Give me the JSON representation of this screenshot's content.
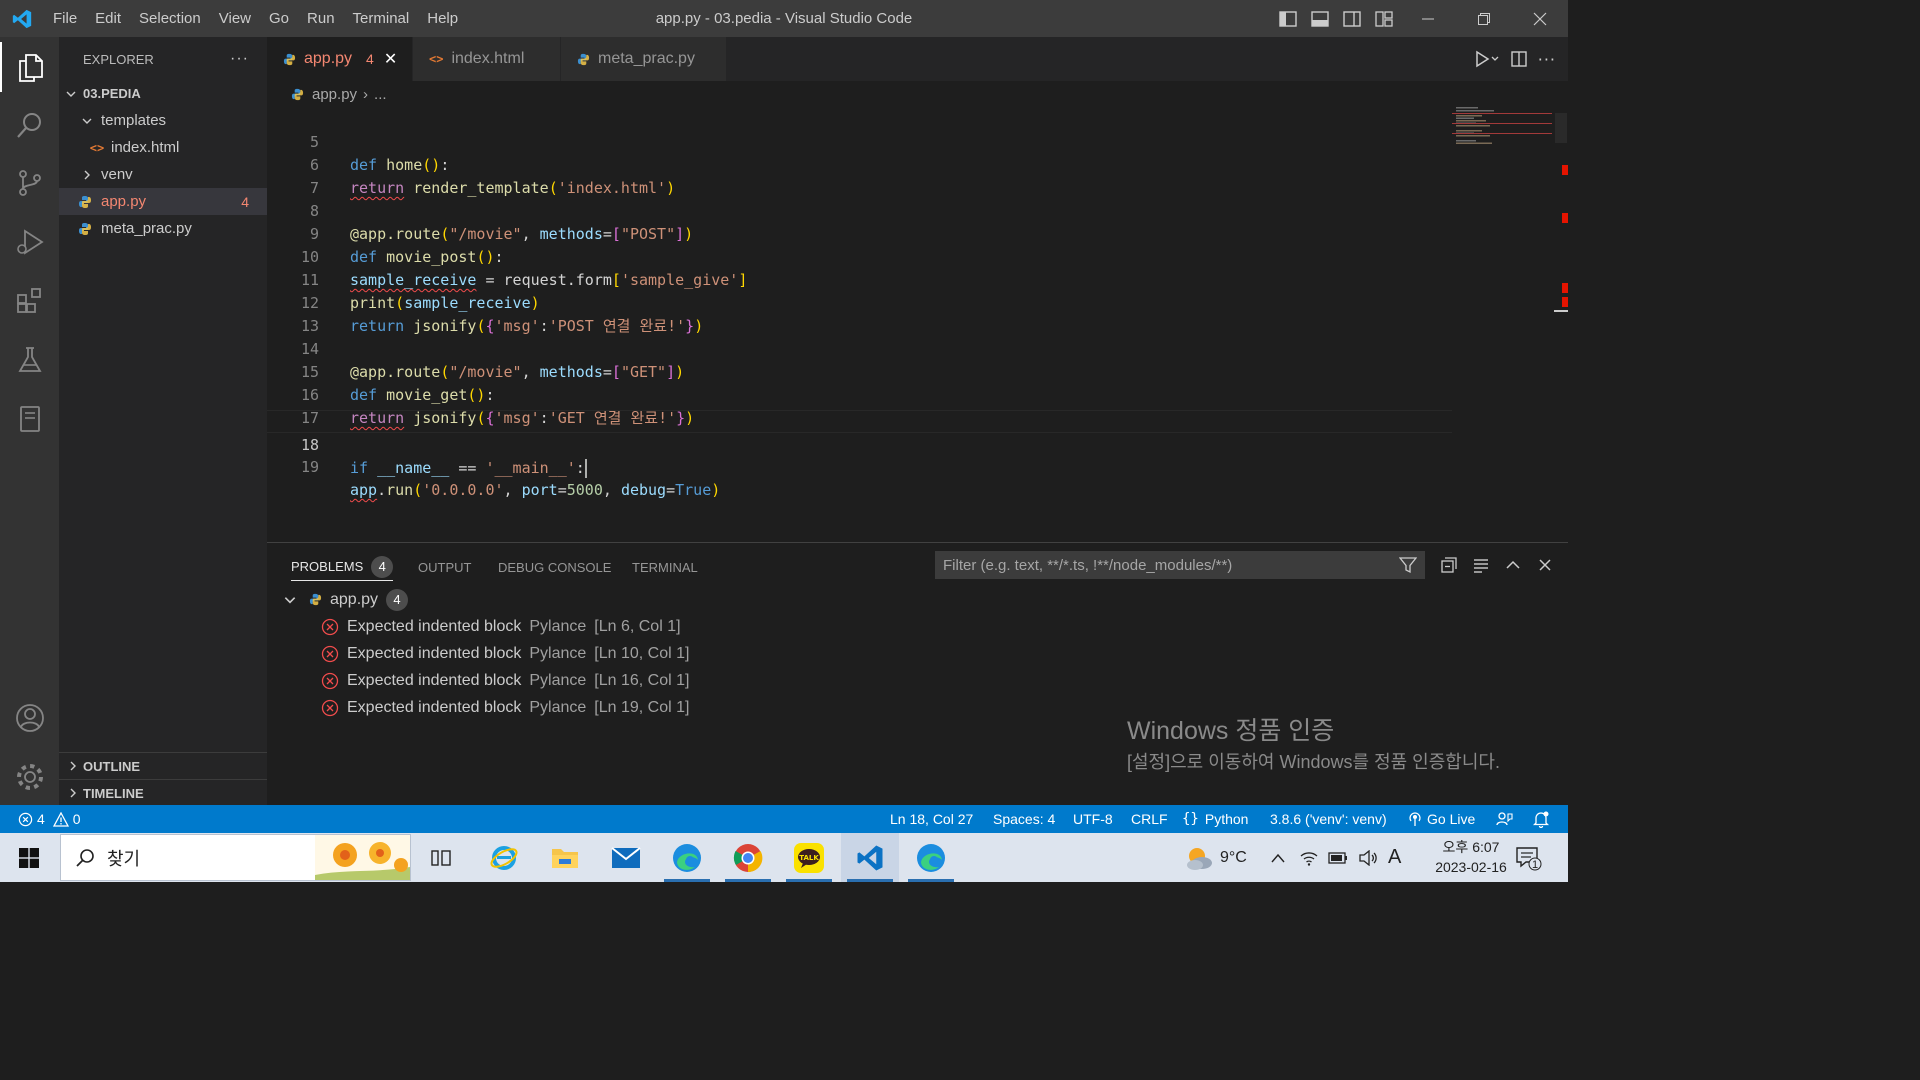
{
  "window": {
    "title": "app.py - 03.pedia - Visual Studio Code",
    "menu": [
      "File",
      "Edit",
      "Selection",
      "View",
      "Go",
      "Run",
      "Terminal",
      "Help"
    ]
  },
  "sidebar": {
    "title": "EXPLORER",
    "more": "···",
    "project": "03.PEDIA",
    "tree": [
      {
        "label": "templates",
        "type": "folder",
        "expanded": true
      },
      {
        "label": "index.html",
        "type": "html"
      },
      {
        "label": "venv",
        "type": "folder",
        "expanded": false
      },
      {
        "label": "app.py",
        "type": "python",
        "badge": "4",
        "selected": true
      },
      {
        "label": "meta_prac.py",
        "type": "python"
      }
    ],
    "outline": "OUTLINE",
    "timeline": "TIMELINE"
  },
  "tabs": [
    {
      "label": "app.py",
      "badge": "4",
      "active": true,
      "close": "✕"
    },
    {
      "label": "index.html"
    },
    {
      "label": "meta_prac.py"
    }
  ],
  "breadcrumb": {
    "file": "app.py",
    "sep": "›",
    "rest": "..."
  },
  "editor": {
    "line_numbers": [
      "5",
      "6",
      "7",
      "8",
      "9",
      "10",
      "11",
      "12",
      "13",
      "14",
      "15",
      "16",
      "17",
      "18",
      "19"
    ],
    "current_line": "18",
    "tokens": {
      "def": "def",
      "return": "return",
      "if": "if",
      "home": "home",
      "render_template": "render_template",
      "index_html": "'index.html'",
      "decorator": "@app.route",
      "movie_route": "\"/movie\"",
      "methods": "methods",
      "post": "\"POST\"",
      "get": "\"GET\"",
      "movie_post": "movie_post",
      "movie_get": "movie_get",
      "sample_receive": "sample_receive",
      "request_form": "request.form",
      "sample_give": "'sample_give'",
      "print": "print",
      "jsonify": "jsonify",
      "msg": "'msg'",
      "post_msg": "'POST 연결 완료!'",
      "get_msg": "'GET 연결 완료!'",
      "name": "__name__",
      "main": "'__main__'",
      "app": "app",
      "run": "run",
      "host": "'0.0.0.0'",
      "port": "port",
      "port_val": "5000",
      "debug": "debug",
      "true": "True"
    }
  },
  "panel": {
    "tabs": [
      {
        "label": "PROBLEMS",
        "badge": "4",
        "active": true
      },
      {
        "label": "OUTPUT"
      },
      {
        "label": "DEBUG CONSOLE"
      },
      {
        "label": "TERMINAL"
      }
    ],
    "filter_placeholder": "Filter (e.g. text, **/*.ts, !**/node_modules/**)",
    "file": {
      "label": "app.py",
      "badge": "4"
    },
    "problems": [
      {
        "message": "Expected indented block",
        "source": "Pylance",
        "location": "[Ln 6, Col 1]"
      },
      {
        "message": "Expected indented block",
        "source": "Pylance",
        "location": "[Ln 10, Col 1]"
      },
      {
        "message": "Expected indented block",
        "source": "Pylance",
        "location": "[Ln 16, Col 1]"
      },
      {
        "message": "Expected indented block",
        "source": "Pylance",
        "location": "[Ln 19, Col 1]"
      }
    ],
    "watermark": {
      "title": "Windows 정품 인증",
      "subtitle": "[설정]으로 이동하여 Windows를 정품 인증합니다."
    }
  },
  "statusbar": {
    "errors": "4",
    "warnings": "0",
    "position": "Ln 18, Col 27",
    "spaces": "Spaces: 4",
    "encoding": "UTF-8",
    "eol": "CRLF",
    "language": "Python",
    "interpreter": "3.8.6 ('venv': venv)",
    "golive": "Go Live"
  },
  "taskbar": {
    "search_placeholder": "찾기",
    "weather": "9°C",
    "ime": "A",
    "time": "오후 6:07",
    "date": "2023-02-16",
    "notifications": "1"
  },
  "colors": {
    "accent": "#007acc",
    "error": "#f14c4c",
    "tab_error": "#f48771"
  }
}
